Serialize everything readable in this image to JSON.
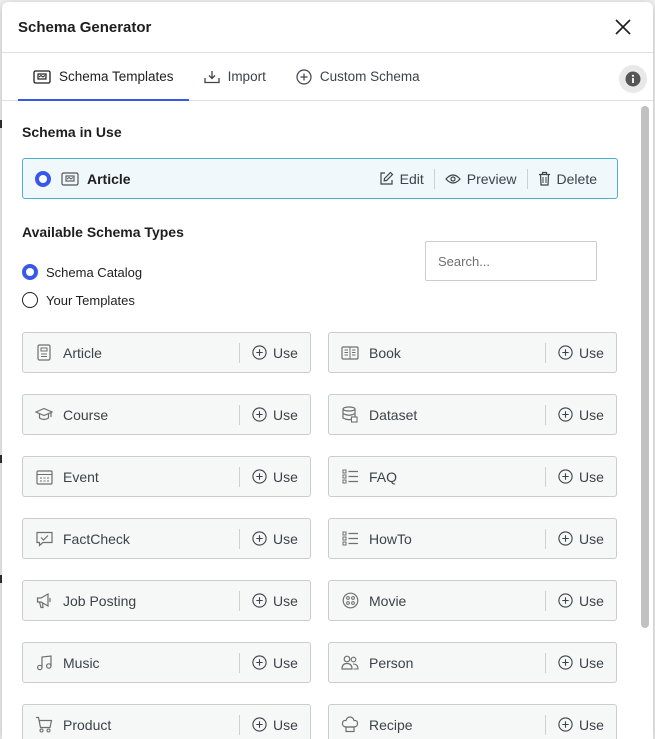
{
  "modal": {
    "title": "Schema Generator"
  },
  "tabs": [
    {
      "label": "Schema Templates",
      "icon": "template-icon",
      "active": true
    },
    {
      "label": "Import",
      "icon": "import-icon",
      "active": false
    },
    {
      "label": "Custom Schema",
      "icon": "plus-circle-icon",
      "active": false
    }
  ],
  "in_use": {
    "title": "Schema in Use",
    "name": "Article",
    "edit_label": "Edit",
    "preview_label": "Preview",
    "delete_label": "Delete"
  },
  "available": {
    "title": "Available Schema Types",
    "option_catalog": "Schema Catalog",
    "option_templates": "Your Templates",
    "selected": "Schema Catalog",
    "search_placeholder": "Search..."
  },
  "use_label": "Use",
  "schema_types": [
    {
      "label": "Article",
      "icon": "article-icon"
    },
    {
      "label": "Book",
      "icon": "book-icon"
    },
    {
      "label": "Course",
      "icon": "graduation-cap-icon"
    },
    {
      "label": "Dataset",
      "icon": "database-icon"
    },
    {
      "label": "Event",
      "icon": "calendar-icon"
    },
    {
      "label": "FAQ",
      "icon": "list-icon"
    },
    {
      "label": "FactCheck",
      "icon": "check-comment-icon"
    },
    {
      "label": "HowTo",
      "icon": "list-icon"
    },
    {
      "label": "Job Posting",
      "icon": "megaphone-icon"
    },
    {
      "label": "Movie",
      "icon": "film-reel-icon"
    },
    {
      "label": "Music",
      "icon": "music-note-icon"
    },
    {
      "label": "Person",
      "icon": "people-icon"
    },
    {
      "label": "Product",
      "icon": "cart-icon"
    },
    {
      "label": "Recipe",
      "icon": "chef-hat-icon"
    }
  ],
  "colors": {
    "accent": "#3858e9",
    "in_use_border": "#4ab2c9",
    "in_use_bg": "#f0f8fc"
  }
}
